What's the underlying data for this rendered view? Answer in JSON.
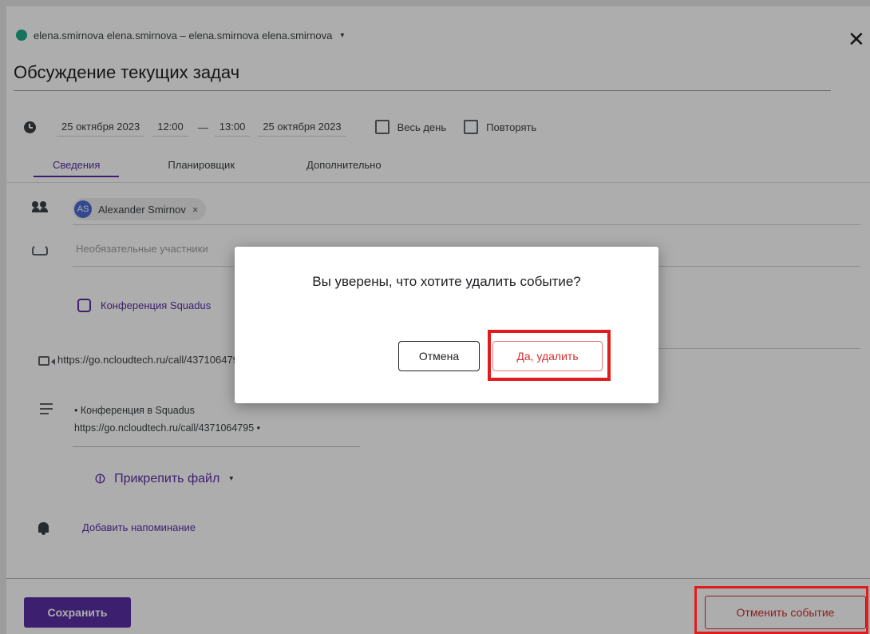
{
  "header": {
    "calendar_label": "elena.smirnova elena.smirnova – elena.smirnova elena.smirnova",
    "calendar_caret": "▾",
    "calendar_color": "#1fa88a",
    "close_glyph": "✕"
  },
  "event": {
    "title": "Обсуждение текущих задач",
    "start_date": "25 октября 2023",
    "start_time": "12:00",
    "dash": "—",
    "end_time": "13:00",
    "end_date": "25 октября 2023",
    "all_day_label": "Весь день",
    "repeat_label": "Повторять"
  },
  "tabs": [
    {
      "label": "Сведения",
      "active": true
    },
    {
      "label": "Планировщик",
      "active": false
    },
    {
      "label": "Дополнительно",
      "active": false
    }
  ],
  "participants": {
    "required": [
      {
        "initials": "AS",
        "name": "Alexander Smirnov",
        "remove": "×"
      }
    ],
    "optional_placeholder": "Необязательные участники"
  },
  "conference": {
    "label": "Конференция Squadus",
    "link": "https://go.ncloudtech.ru/call/4371064795"
  },
  "description": {
    "line1": "• Конференция в Squadus",
    "line2": "https://go.ncloudtech.ru/call/4371064795 •"
  },
  "attach": {
    "label": "Прикрепить файл",
    "caret": "▾"
  },
  "reminder": {
    "label": "Добавить напоминание"
  },
  "footer": {
    "save_label": "Сохранить",
    "cancel_event_label": "Отменить событие"
  },
  "dialog": {
    "message": "Вы уверены, что хотите удалить событие?",
    "cancel_label": "Отмена",
    "confirm_label": "Да, удалить"
  },
  "colors": {
    "accent": "#5b2ea6",
    "danger": "#d32f2f",
    "highlight": "#e01c1c"
  }
}
